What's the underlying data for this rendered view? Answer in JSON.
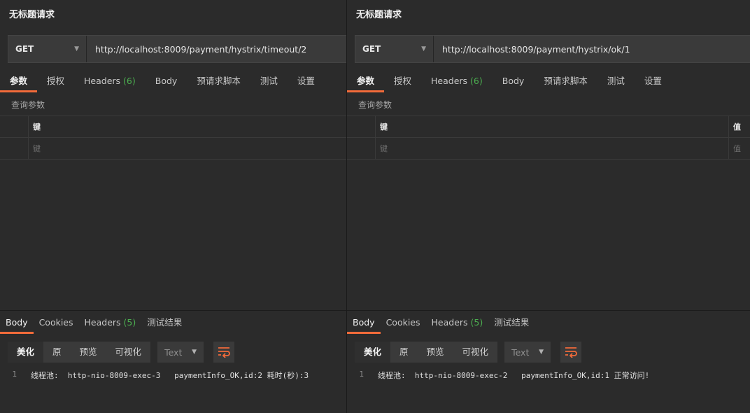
{
  "colors": {
    "accent": "#f26b3a",
    "count": "#4caf50",
    "bg": "#2b2b2b"
  },
  "left": {
    "title": "无标题请求",
    "method": "GET",
    "url": "http://localhost:8009/payment/hystrix/timeout/2",
    "tabs": [
      {
        "label": "参数"
      },
      {
        "label": "授权"
      },
      {
        "label": "Headers",
        "count": "(6)"
      },
      {
        "label": "Body"
      },
      {
        "label": "预请求脚本"
      },
      {
        "label": "测试"
      },
      {
        "label": "设置"
      }
    ],
    "params_label": "查询参数",
    "key_header": "键",
    "key_placeholder": "键",
    "response_tabs": [
      {
        "label": "Body"
      },
      {
        "label": "Cookies"
      },
      {
        "label": "Headers",
        "count": "(5)"
      },
      {
        "label": "测试结果"
      }
    ],
    "view_modes": [
      "美化",
      "原",
      "预览",
      "可视化"
    ],
    "format": "Text",
    "line_number": "1",
    "response_line": "线程池:  http-nio-8009-exec-3   paymentInfo_OK,id:2 耗时(秒):3"
  },
  "right": {
    "title": "无标题请求",
    "method": "GET",
    "url": "http://localhost:8009/payment/hystrix/ok/1",
    "tabs": [
      {
        "label": "参数"
      },
      {
        "label": "授权"
      },
      {
        "label": "Headers",
        "count": "(6)"
      },
      {
        "label": "Body"
      },
      {
        "label": "预请求脚本"
      },
      {
        "label": "测试"
      },
      {
        "label": "设置"
      }
    ],
    "params_label": "查询参数",
    "key_header": "键",
    "key_placeholder": "键",
    "value_header": "值",
    "value_placeholder": "值",
    "response_tabs": [
      {
        "label": "Body"
      },
      {
        "label": "Cookies"
      },
      {
        "label": "Headers",
        "count": "(5)"
      },
      {
        "label": "测试结果"
      }
    ],
    "view_modes": [
      "美化",
      "原",
      "预览",
      "可视化"
    ],
    "format": "Text",
    "line_number": "1",
    "response_line": "线程池:  http-nio-8009-exec-2   paymentInfo_OK,id:1 正常访问!"
  }
}
